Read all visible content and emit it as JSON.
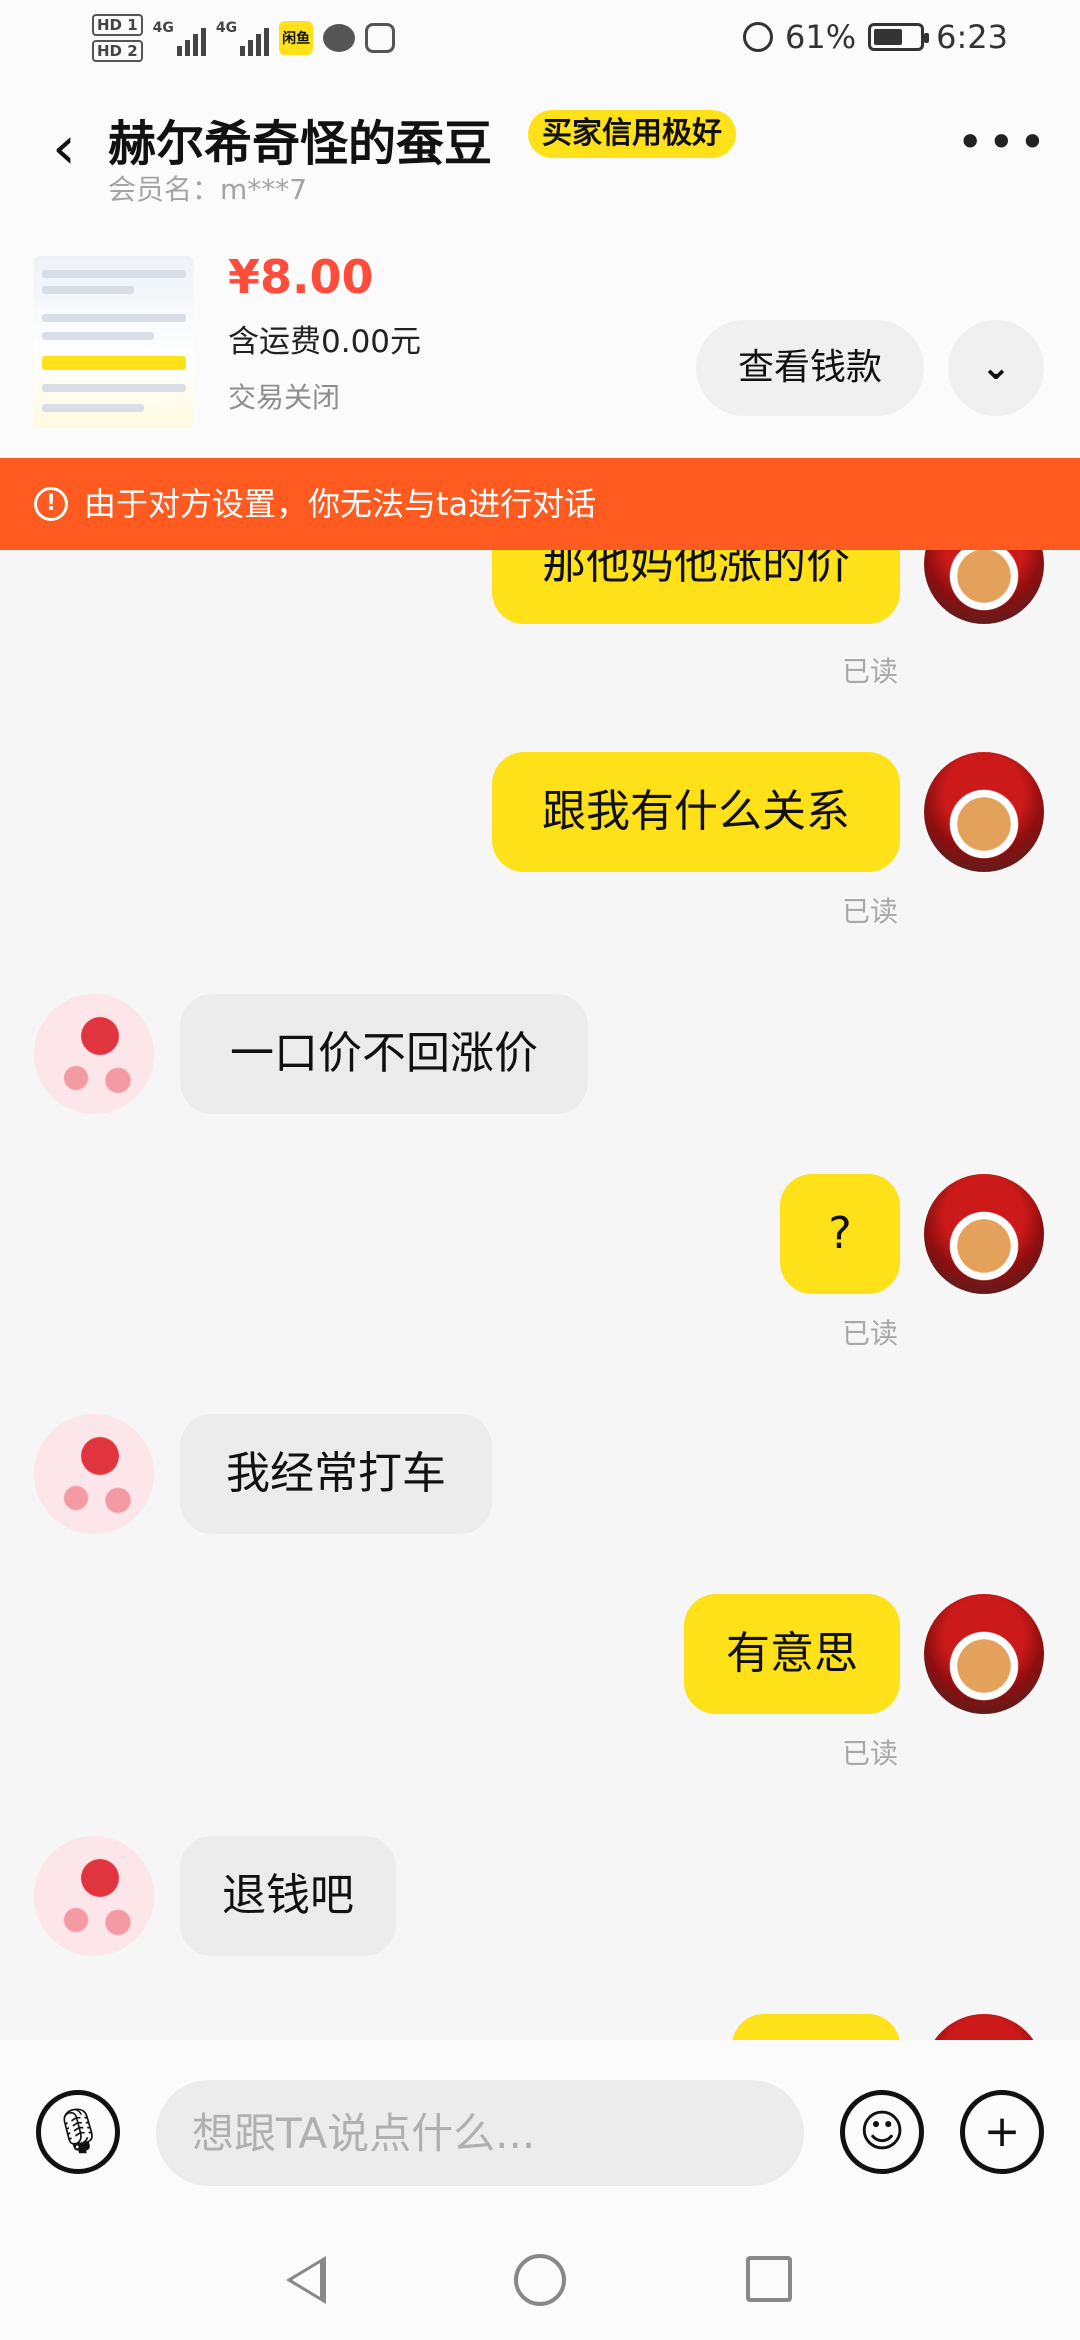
{
  "status_bar": {
    "hd1": "HD 1",
    "hd2": "HD 2",
    "net1": "4G",
    "net2": "4G",
    "app_icon": "闲鱼",
    "battery": "61%",
    "time": "6:23"
  },
  "header": {
    "title": "赫尔希奇怪的蚕豆",
    "badge": "买家信用极好",
    "member": "会员名：m***7",
    "more_label": "•••"
  },
  "product": {
    "price": "¥8.00",
    "shipping": "含运费0.00元",
    "status": "交易关闭",
    "view_button": "查看钱款",
    "expand_icon": "⌄"
  },
  "banner": {
    "icon": "!",
    "text": "由于对方设置，你无法与ta进行对话"
  },
  "messages": [
    {
      "from": "me",
      "text": "那他妈他涨的价",
      "read": "已读"
    },
    {
      "from": "me",
      "text": "跟我有什么关系",
      "read": "已读"
    },
    {
      "from": "them",
      "text": "一口价不回涨价"
    },
    {
      "from": "me",
      "text": "?",
      "read": "已读"
    },
    {
      "from": "them",
      "text": "我经常打车"
    },
    {
      "from": "me",
      "text": "有意思",
      "read": "已读"
    },
    {
      "from": "them",
      "text": "退钱吧"
    },
    {
      "from": "me",
      "text": ""
    }
  ],
  "input": {
    "placeholder": "想跟TA说点什么..."
  },
  "icons": {
    "mic": "mic-icon",
    "emoji": "emoji-icon",
    "plus": "plus-icon"
  }
}
